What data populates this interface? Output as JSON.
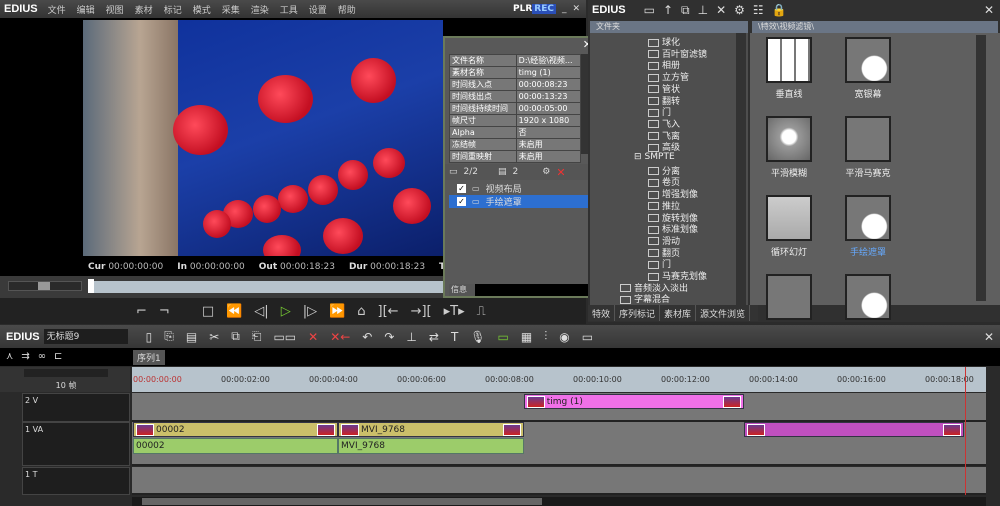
{
  "player": {
    "logo": "EDIUS",
    "menu": [
      "文件",
      "编辑",
      "视图",
      "素材",
      "标记",
      "模式",
      "采集",
      "渲染",
      "工具",
      "设置",
      "帮助"
    ],
    "plr": "PLR",
    "rec": "REC",
    "timecodes": [
      {
        "label": "Cur",
        "value": "00:00:00:00"
      },
      {
        "label": "In",
        "value": "00:00:00:00"
      },
      {
        "label": "Out",
        "value": "00:00:18:23"
      },
      {
        "label": "Dur",
        "value": "00:00:18:23"
      },
      {
        "label": "Ttl",
        "value": ""
      }
    ]
  },
  "info_panel": {
    "rows": [
      [
        "文件名称",
        "D:\\经验\\视频..."
      ],
      [
        "素材名称",
        "timg (1)"
      ],
      [
        "时间线入点",
        "00:00:08:23"
      ],
      [
        "时间线出点",
        "00:00:13:23"
      ],
      [
        "时间线持续时间",
        "00:00:05:00"
      ],
      [
        "帧尺寸",
        "1920 x 1080"
      ],
      [
        "Alpha",
        "否"
      ],
      [
        "冻结帧",
        "未启用"
      ],
      [
        "时间重映射",
        "未启用"
      ]
    ],
    "count1": "2/2",
    "count2": "2",
    "filters": [
      {
        "label": "视频布局",
        "checked": true,
        "selected": false
      },
      {
        "label": "手绘遮罩",
        "checked": true,
        "selected": true
      }
    ],
    "footer": "信息"
  },
  "effects": {
    "logo": "EDIUS",
    "folder_header": "文件夹",
    "path": "\\特效\\视频滤镜\\",
    "tree": [
      {
        "label": "球化",
        "indent": 1
      },
      {
        "label": "百叶窗滤镜",
        "indent": 1
      },
      {
        "label": "相册",
        "indent": 1
      },
      {
        "label": "立方管",
        "indent": 1
      },
      {
        "label": "管状",
        "indent": 1
      },
      {
        "label": "翻转",
        "indent": 1
      },
      {
        "label": "门",
        "indent": 1
      },
      {
        "label": "飞入",
        "indent": 1
      },
      {
        "label": "飞离",
        "indent": 1
      },
      {
        "label": "高级",
        "indent": 1
      },
      {
        "label": "SMPTE",
        "indent": 0
      },
      {
        "label": "分离",
        "indent": 1
      },
      {
        "label": "卷页",
        "indent": 1
      },
      {
        "label": "增强划像",
        "indent": 1
      },
      {
        "label": "推拉",
        "indent": 1
      },
      {
        "label": "旋转划像",
        "indent": 1
      },
      {
        "label": "标准划像",
        "indent": 1
      },
      {
        "label": "滑动",
        "indent": 1
      },
      {
        "label": "翻页",
        "indent": 1
      },
      {
        "label": "门",
        "indent": 1
      },
      {
        "label": "马赛克划像",
        "indent": 1
      },
      {
        "label": "音频淡入淡出",
        "indent": -1
      },
      {
        "label": "字幕混合",
        "indent": -1
      }
    ],
    "thumbs": [
      {
        "label": "垂直线"
      },
      {
        "label": "宽银幕"
      },
      {
        "label": "平滑模糊"
      },
      {
        "label": "平滑马赛克"
      },
      {
        "label": "循环幻灯"
      },
      {
        "label": "手绘遮罩",
        "selected": true
      },
      {
        "label": ""
      },
      {
        "label": ""
      }
    ],
    "tabs": [
      "特效",
      "序列标记",
      "素材库",
      "源文件浏览"
    ]
  },
  "timeline": {
    "logo": "EDIUS",
    "project": "无标题9",
    "sequence_tab": "序列1",
    "zoom": "10 帧",
    "ruler": [
      "00:00:00:00",
      "00:00:02:00",
      "00:00:04:00",
      "00:00:06:00",
      "00:00:08:00",
      "00:00:10:00",
      "00:00:12:00",
      "00:00:14:00",
      "00:00:16:00",
      "00:00:18:00"
    ],
    "tracks": [
      {
        "name": "2 V"
      },
      {
        "name": "1 VA"
      },
      {
        "name": "1 T"
      }
    ],
    "clips": [
      {
        "track": "2 V",
        "name": "timg (1)",
        "start_s": 8.88,
        "end_s": 13.88,
        "color": "#f070e8"
      },
      {
        "track": "1 VA",
        "name": "00002",
        "start_s": 0,
        "end_s": 4.66,
        "color": "#cbbf6a"
      },
      {
        "track": "1 VA",
        "name": "MVI_9768",
        "start_s": 4.66,
        "end_s": 8.88,
        "color": "#cbbf6a"
      },
      {
        "track": "1 VA",
        "name": "",
        "start_s": 13.88,
        "end_s": 18.88,
        "color": "#c050c0"
      }
    ],
    "audio_clips": [
      {
        "name": "00002",
        "start_s": 0,
        "end_s": 4.66
      },
      {
        "name": "MVI_9768",
        "start_s": 4.66,
        "end_s": 8.88
      }
    ]
  }
}
